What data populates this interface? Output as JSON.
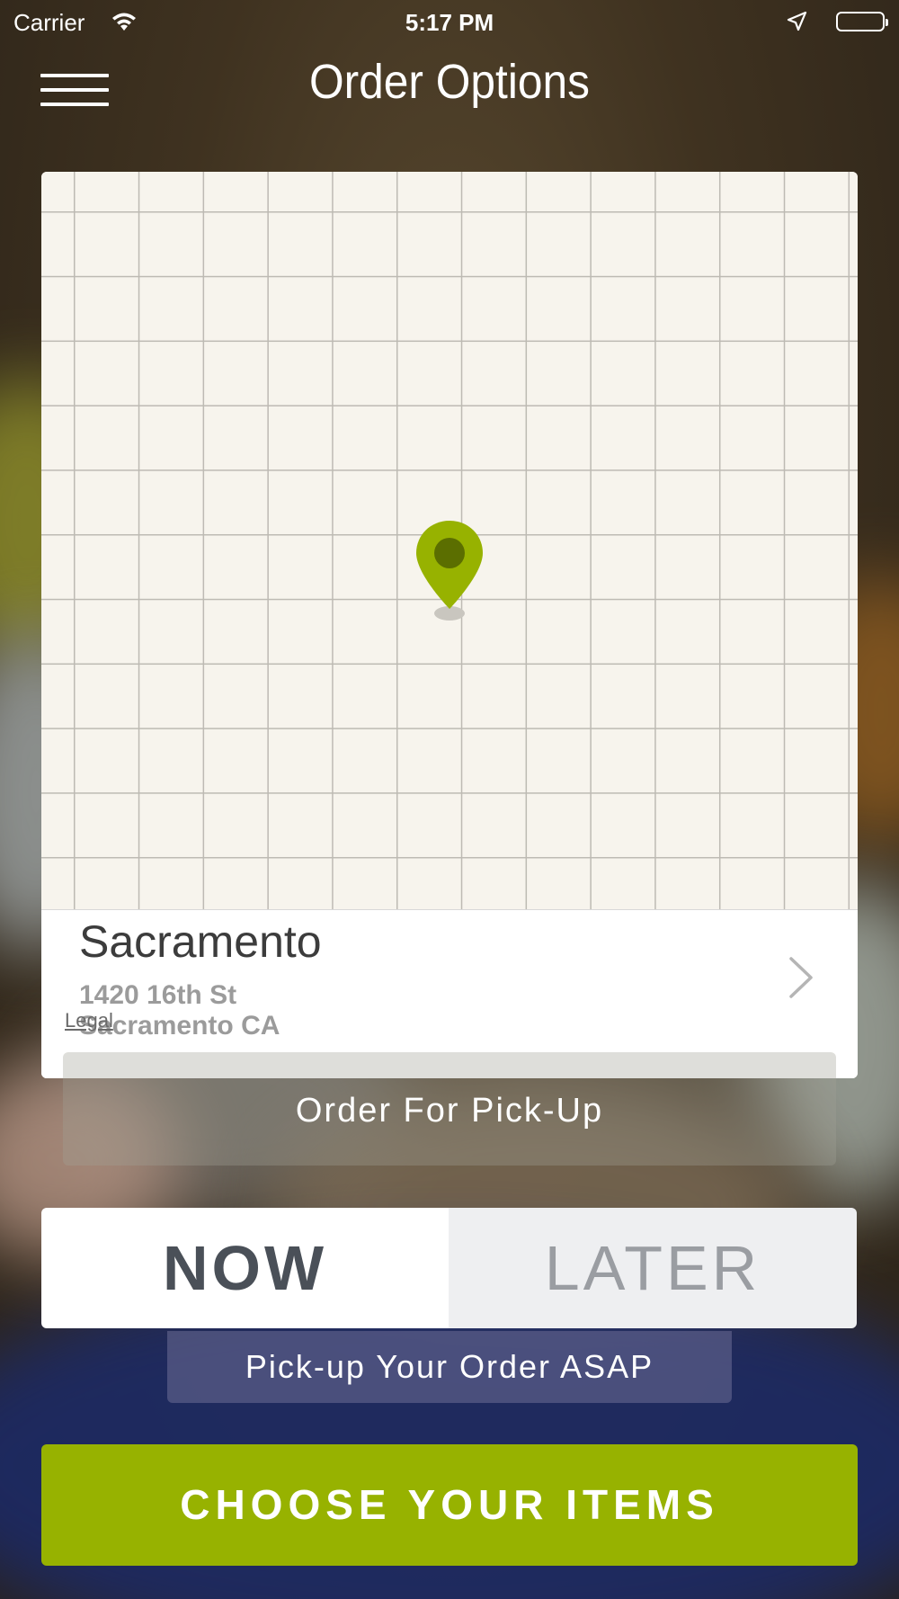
{
  "status_bar": {
    "carrier": "Carrier",
    "time": "5:17 PM",
    "wifi_icon": "wifi-icon",
    "location_icon": "location-arrow-icon",
    "battery_icon": "battery-icon"
  },
  "nav": {
    "title": "Order Options",
    "menu_icon": "hamburger-menu-icon"
  },
  "map": {
    "pin_icon": "map-pin-icon",
    "pin_color": "#97b200"
  },
  "location": {
    "name": "Sacramento",
    "street": "1420 16th St",
    "city": "Sacramento CA",
    "legal": "Legal",
    "chevron_icon": "chevron-right-icon"
  },
  "order_type": {
    "label": "Order For Pick-Up"
  },
  "timing": {
    "options": [
      "NOW",
      "LATER"
    ],
    "selected": "NOW",
    "note": "Pick-up Your Order ASAP"
  },
  "cta": {
    "label": "CHOOSE YOUR ITEMS",
    "color": "#97b200"
  }
}
